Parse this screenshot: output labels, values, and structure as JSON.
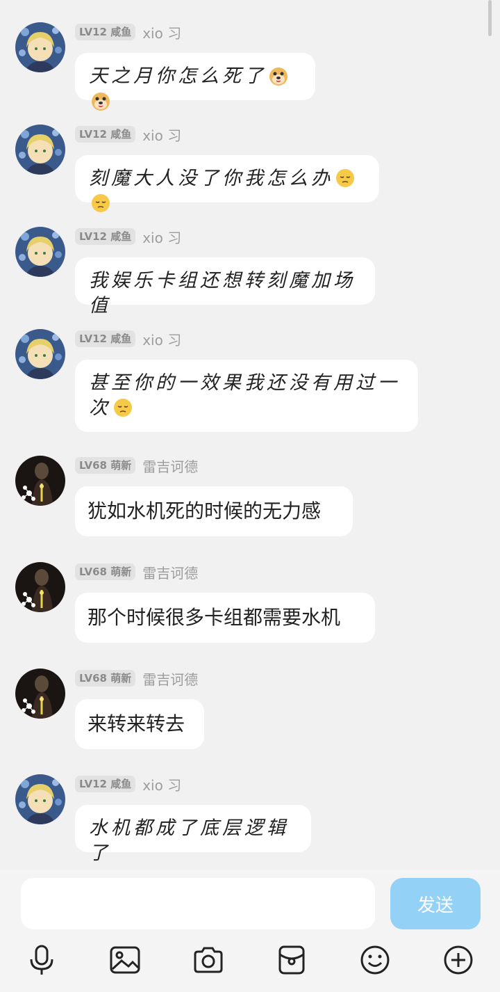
{
  "messages": [
    {
      "level": "LV12 咸鱼",
      "name": "xio 习",
      "text": "天之月你怎么死了",
      "emojis": [
        "dog-icon",
        "dog-icon"
      ],
      "avatar": "blonde-girl-avatar"
    },
    {
      "level": "LV12 咸鱼",
      "name": "xio 习",
      "text": "刻魔大人没了你我怎么办",
      "emojis": [
        "pensive-face-icon",
        "pensive-face-icon"
      ],
      "avatar": "blonde-girl-avatar"
    },
    {
      "level": "LV12 咸鱼",
      "name": "xio 习",
      "text": "我娱乐卡组还想转刻魔加场值",
      "emojis": [],
      "avatar": "blonde-girl-avatar"
    },
    {
      "level": "LV12 咸鱼",
      "name": "xio 习",
      "text": "甚至你的一效果我还没有用过一次",
      "emojis": [
        "pensive-face-icon"
      ],
      "avatar": "blonde-girl-avatar"
    },
    {
      "level": "LV68 萌新",
      "name": "雷吉诃德",
      "text": "犹如水机死的时候的无力感",
      "emojis": [],
      "avatar": "dark-character-avatar"
    },
    {
      "level": "LV68 萌新",
      "name": "雷吉诃德",
      "text": "那个时候很多卡组都需要水机",
      "emojis": [],
      "avatar": "dark-character-avatar"
    },
    {
      "level": "LV68 萌新",
      "name": "雷吉诃德",
      "text": "来转来转去",
      "emojis": [],
      "avatar": "dark-character-avatar"
    },
    {
      "level": "LV12 咸鱼",
      "name": "xio 习",
      "text": "水机都成了底层逻辑了",
      "emojis": [],
      "avatar": "blonde-girl-avatar"
    }
  ],
  "input": {
    "value": "",
    "placeholder": ""
  },
  "send_label": "发送",
  "toolbar": [
    "microphone-icon",
    "image-icon",
    "camera-icon",
    "red-packet-icon",
    "emoji-icon",
    "plus-icon"
  ],
  "colors": {
    "background": "#f1f1f1",
    "bubble": "#ffffff",
    "send_button": "#94d1f7",
    "badge_bg": "#e2e2e2"
  }
}
